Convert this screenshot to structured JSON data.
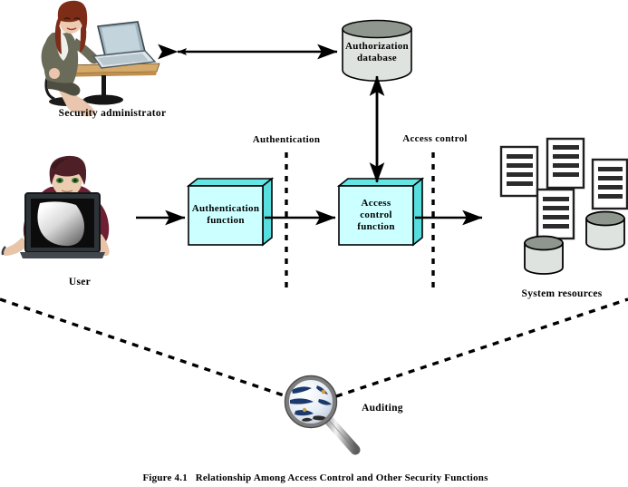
{
  "figure": {
    "caption_number": "Figure 4.1",
    "caption_text": "Relationship Among Access Control and Other Security Functions"
  },
  "nodes": {
    "security_admin": {
      "label": "Security administrator",
      "icon": "woman-at-laptop-icon"
    },
    "user": {
      "label": "User",
      "icon": "man-at-monitor-icon"
    },
    "authorization_database": {
      "label_line1": "Authorization",
      "label_line2": "database",
      "icon": "database-cylinder-icon"
    },
    "authentication_function": {
      "label_line1": "Authentication",
      "label_line2": "function",
      "icon": "process-box-3d-icon"
    },
    "access_control_function": {
      "label_line1": "Access",
      "label_line2": "control",
      "label_line3": "function",
      "icon": "process-box-3d-icon"
    },
    "system_resources": {
      "label": "System resources",
      "icon": "documents-and-databases-icon",
      "document_count": 4,
      "cylinder_count": 2
    },
    "auditing": {
      "label": "Auditing",
      "icon": "magnifying-glass-globe-icon"
    }
  },
  "zones": {
    "authentication_boundary": "Authentication",
    "access_control_boundary": "Access control"
  },
  "colors": {
    "box_fill": "#ccffff",
    "box_top": "#66e5e5",
    "box_side": "#57dede",
    "cylinder_fill": "#dfe3df",
    "cylinder_top": "#8e968e",
    "stroke": "#000000",
    "document_line": "#2b2b2b",
    "globe_blue": "#1b3a6b"
  }
}
